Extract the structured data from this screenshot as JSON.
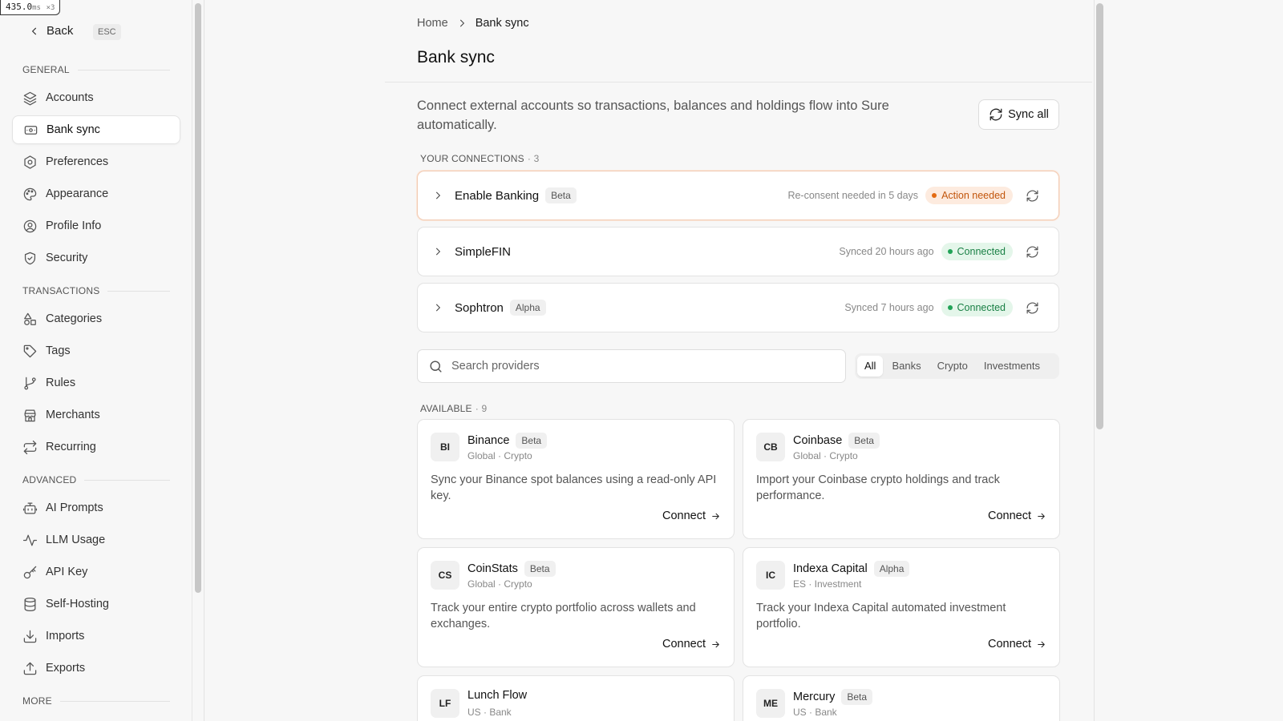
{
  "perf": {
    "value": "435.0",
    "unit": "ms",
    "mult": "×3"
  },
  "sidebar": {
    "back_label": "Back",
    "esc_label": "ESC",
    "sections": {
      "general": "GENERAL",
      "transactions": "TRANSACTIONS",
      "advanced": "ADVANCED",
      "more": "MORE"
    },
    "items": [
      {
        "label": "Accounts",
        "icon": "layers-icon"
      },
      {
        "label": "Bank sync",
        "icon": "bank-sync-icon",
        "active": true
      },
      {
        "label": "Preferences",
        "icon": "gear-icon"
      },
      {
        "label": "Appearance",
        "icon": "palette-icon"
      },
      {
        "label": "Profile Info",
        "icon": "user-circle-icon"
      },
      {
        "label": "Security",
        "icon": "shield-icon"
      },
      {
        "label": "Categories",
        "icon": "shapes-icon"
      },
      {
        "label": "Tags",
        "icon": "tag-icon"
      },
      {
        "label": "Rules",
        "icon": "git-branch-icon"
      },
      {
        "label": "Merchants",
        "icon": "store-icon"
      },
      {
        "label": "Recurring",
        "icon": "repeat-icon"
      },
      {
        "label": "AI Prompts",
        "icon": "bot-icon"
      },
      {
        "label": "LLM Usage",
        "icon": "activity-icon"
      },
      {
        "label": "API Key",
        "icon": "key-icon"
      },
      {
        "label": "Self-Hosting",
        "icon": "database-icon"
      },
      {
        "label": "Imports",
        "icon": "download-icon"
      },
      {
        "label": "Exports",
        "icon": "upload-icon"
      }
    ]
  },
  "breadcrumb": {
    "home": "Home",
    "current": "Bank sync"
  },
  "page": {
    "title": "Bank sync",
    "description": "Connect external accounts so transactions, balances and holdings flow into Sure automatically.",
    "sync_all_label": "Sync all"
  },
  "connections": {
    "label": "YOUR CONNECTIONS",
    "count": "· 3",
    "items": [
      {
        "name": "Enable Banking",
        "tag": "Beta",
        "meta": "Re-consent needed in 5 days",
        "status": "Action needed",
        "status_color": "#e36a12"
      },
      {
        "name": "SimpleFIN",
        "tag": "",
        "meta": "Synced 20 hours ago",
        "status": "Connected",
        "status_color": "#21a357"
      },
      {
        "name": "Sophtron",
        "tag": "Alpha",
        "meta": "Synced 7 hours ago",
        "status": "Connected",
        "status_color": "#21a357"
      }
    ]
  },
  "search": {
    "placeholder": "Search providers"
  },
  "filters": [
    "All",
    "Banks",
    "Crypto",
    "Investments"
  ],
  "active_filter": "All",
  "available": {
    "label": "AVAILABLE",
    "count": "· 9",
    "connect_label": "Connect",
    "providers": [
      {
        "abbr": "BI",
        "name": "Binance",
        "tag": "Beta",
        "sub": "Global · Crypto",
        "desc": "Sync your Binance spot balances using a read-only API key."
      },
      {
        "abbr": "CB",
        "name": "Coinbase",
        "tag": "Beta",
        "sub": "Global · Crypto",
        "desc": "Import your Coinbase crypto holdings and track performance."
      },
      {
        "abbr": "CS",
        "name": "CoinStats",
        "tag": "Beta",
        "sub": "Global · Crypto",
        "desc": "Track your entire crypto portfolio across wallets and exchanges."
      },
      {
        "abbr": "IC",
        "name": "Indexa Capital",
        "tag": "Alpha",
        "sub": "ES · Investment",
        "desc": "Track your Indexa Capital automated investment portfolio."
      },
      {
        "abbr": "LF",
        "name": "Lunch Flow",
        "tag": "",
        "sub": "US · Bank",
        "desc": ""
      },
      {
        "abbr": "ME",
        "name": "Mercury",
        "tag": "Beta",
        "sub": "US · Bank",
        "desc": ""
      }
    ]
  },
  "colors": {
    "accent_warn": "#e36a12",
    "accent_ok": "#21a357"
  }
}
